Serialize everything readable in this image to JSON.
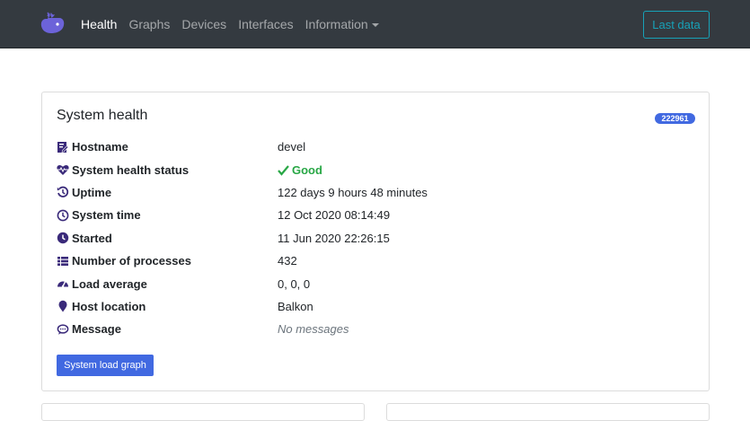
{
  "navbar": {
    "brand_icon": "whale-logo-icon",
    "links": [
      {
        "label": "Health",
        "active": true
      },
      {
        "label": "Graphs",
        "active": false
      },
      {
        "label": "Devices",
        "active": false
      },
      {
        "label": "Interfaces",
        "active": false
      }
    ],
    "dropdown_label": "Information",
    "last_data_label": "Last data",
    "accent_color": "#17a2b8"
  },
  "card": {
    "title": "System health",
    "badge": "222961",
    "rows": [
      {
        "label": "Hostname",
        "icon": "id-card-icon",
        "value": "devel"
      },
      {
        "label": "System health status",
        "icon": "heartbeat-icon",
        "value": "Good"
      },
      {
        "label": "Uptime",
        "icon": "history-icon",
        "value": "122 days 9 hours 48 minutes"
      },
      {
        "label": "System time",
        "icon": "clock-icon",
        "value": "12 Oct 2020 08:14:49"
      },
      {
        "label": "Started",
        "icon": "clock-filled-icon",
        "value": "11 Jun 2020 22:26:15"
      },
      {
        "label": "Number of processes",
        "icon": "list-icon",
        "value": "432"
      },
      {
        "label": "Load average",
        "icon": "gauge-icon",
        "value": "0, 0, 0"
      },
      {
        "label": "Host location",
        "icon": "map-marker-icon",
        "value": "Balkon"
      },
      {
        "label": "Message",
        "icon": "comment-icon",
        "value": "No messages"
      }
    ],
    "graph_button": "System load graph",
    "status_color": "#28a745",
    "primary_color": "#4169e1"
  }
}
